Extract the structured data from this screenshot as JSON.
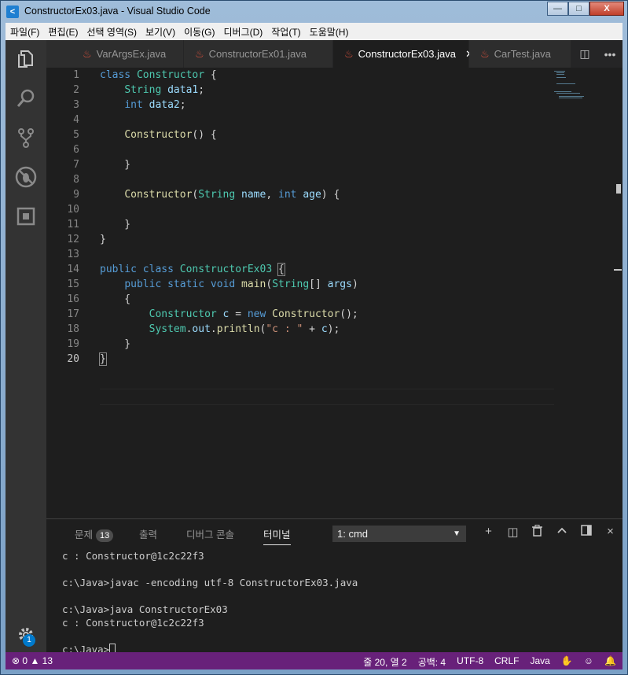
{
  "window": {
    "title": "ConstructorEx03.java - Visual Studio Code",
    "icon_label": "<",
    "min": "—",
    "max": "□",
    "close": "X"
  },
  "menu": [
    "파일(F)",
    "편집(E)",
    "선택 영역(S)",
    "보기(V)",
    "이동(G)",
    "디버그(D)",
    "작업(T)",
    "도움말(H)"
  ],
  "activity": {
    "icons": [
      "files-icon",
      "search-icon",
      "source-control-icon",
      "debug-icon",
      "extensions-icon",
      "settings-gear-icon"
    ],
    "settings_badge": "1"
  },
  "tabs": [
    {
      "label": "VarArgsEx.java",
      "active": false
    },
    {
      "label": "ConstructorEx01.java",
      "active": false
    },
    {
      "label": "ConstructorEx03.java",
      "active": true
    },
    {
      "label": "CarTest.java",
      "active": false
    }
  ],
  "tab_close": "✕",
  "tab_actions": {
    "split": "◫",
    "more": "•••"
  },
  "editor": {
    "current_line": 20,
    "lines": [
      "1",
      "2",
      "3",
      "4",
      "5",
      "6",
      "7",
      "8",
      "9",
      "10",
      "11",
      "12",
      "13",
      "14",
      "15",
      "16",
      "17",
      "18",
      "19",
      "20"
    ]
  },
  "panel": {
    "tabs": [
      {
        "label": "문제",
        "badge": "13"
      },
      {
        "label": "출력"
      },
      {
        "label": "디버그 콘솔"
      },
      {
        "label": "터미널",
        "active": true
      }
    ],
    "terminal_select": "1: cmd",
    "actions": [
      "+",
      "◫",
      "🗑",
      "^",
      "▯",
      "×"
    ],
    "terminal_lines": [
      "c : Constructor@1c2c22f3",
      "",
      "c:\\Java>javac -encoding utf-8 ConstructorEx03.java",
      "",
      "c:\\Java>java ConstructorEx03",
      "c : Constructor@1c2c22f3",
      "",
      "c:\\Java>"
    ]
  },
  "status": {
    "errors": "0",
    "warnings": "13",
    "position": "줄 20, 열 2",
    "spaces": "공백: 4",
    "encoding": "UTF-8",
    "eol": "CRLF",
    "language": "Java"
  }
}
